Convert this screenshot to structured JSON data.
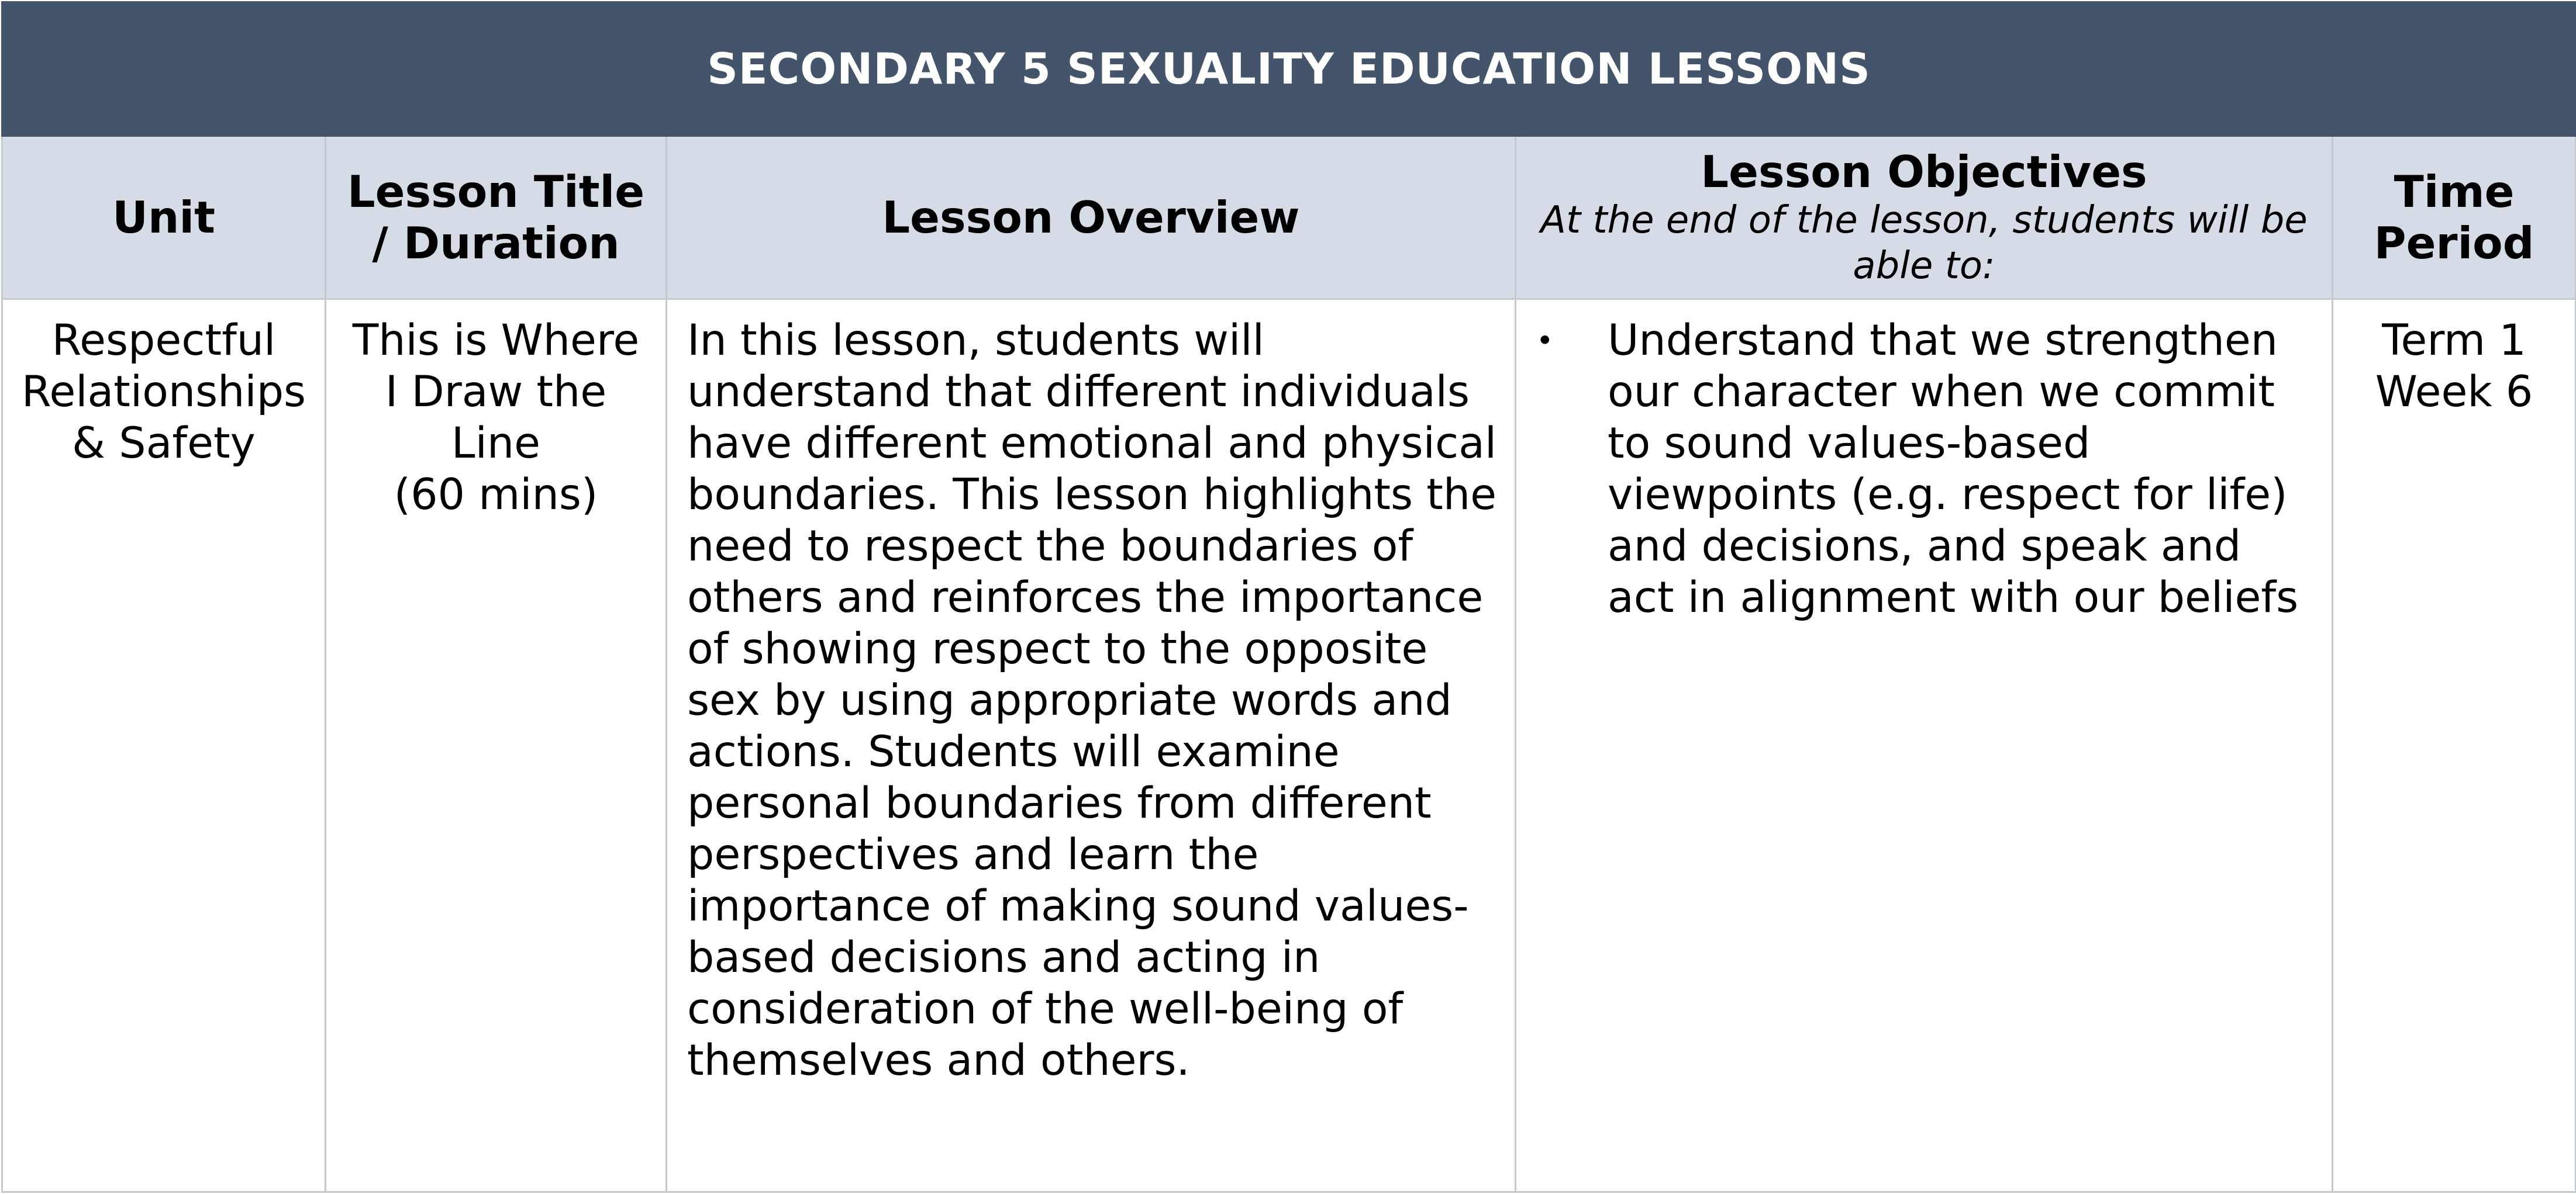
{
  "document": {
    "title": "SECONDARY 5 SEXUALITY EDUCATION LESSONS",
    "columns": {
      "unit": "Unit",
      "lesson_title": "Lesson Title\n/ Duration",
      "overview": "Lesson Overview",
      "objectives": "Lesson Objectives",
      "objectives_subtitle": "At the end of the lesson, students will be able to:",
      "time_period": "Time\nPeriod"
    },
    "rows": [
      {
        "unit": "Respectful\nRelationships\n& Safety",
        "lesson_title": "This is Where\nI Draw the\nLine\n(60 mins)",
        "overview": "In this lesson, students will understand that different individuals have different emotional and physical boundaries. This lesson highlights the need to respect the boundaries of others and reinforces the importance of showing respect to the opposite sex by using appropriate words and actions. Students will examine personal boundaries from different perspectives and learn the importance of making sound values-based decisions and acting in consideration of the well-being of themselves and others.",
        "objectives": [
          "Understand that we strengthen our character when we commit to sound values-based viewpoints (e.g. respect for life) and decisions, and speak and act in alignment with our beliefs"
        ],
        "bullet": "•",
        "time_period": "Term 1\nWeek 6"
      }
    ]
  },
  "colors": {
    "title_bar": "#44546a",
    "header_bg": "#d6dce5",
    "border": "#c4c9d0"
  }
}
